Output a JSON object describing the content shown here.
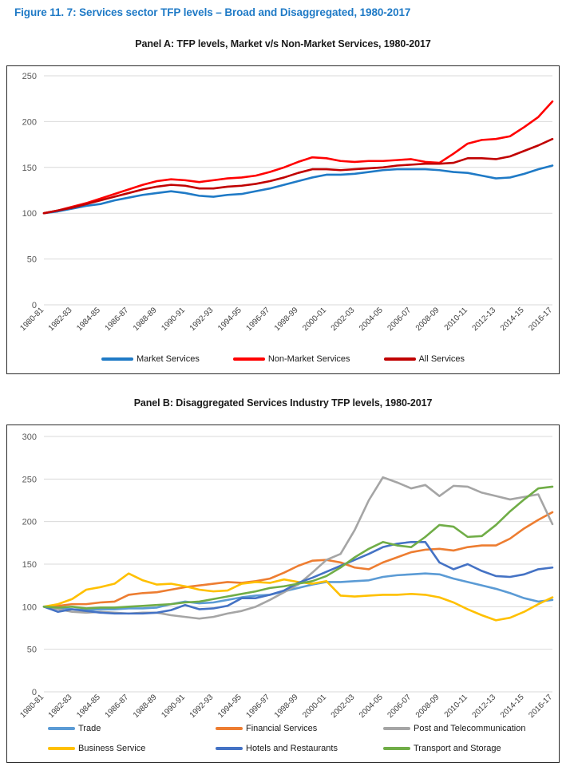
{
  "figure": {
    "title": "Figure 11. 7: Services sector TFP levels – Broad and Disaggregated, 1980-2017",
    "title_color": "#1F7AC6"
  },
  "panelA": {
    "title": "Panel A: TFP levels, Market v/s Non-Market Services, 1980-2017",
    "legend": [
      {
        "label": "Market Services",
        "color": "#1F7AC6"
      },
      {
        "label": "Non-Market Services",
        "color": "#FF0000"
      },
      {
        "label": "All Services",
        "color": "#C00000"
      }
    ]
  },
  "panelB": {
    "title": "Panel B: Disaggregated Services Industry TFP levels, 1980-2017",
    "legend": [
      {
        "label": "Trade",
        "color": "#5B9BD5"
      },
      {
        "label": "Financial Services",
        "color": "#ED7D31"
      },
      {
        "label": "Post and Telecommunication",
        "color": "#A5A5A5"
      },
      {
        "label": "Business Service",
        "color": "#FFC000"
      },
      {
        "label": "Hotels and Restaurants",
        "color": "#4472C4"
      },
      {
        "label": "Transport and Storage",
        "color": "#70AD47"
      }
    ]
  },
  "chart_data": [
    {
      "type": "line",
      "panel": "A",
      "title": "Panel A: TFP levels, Market v/s Non-Market Services, 1980-2017",
      "xlabel": "",
      "ylabel": "",
      "ylim": [
        0,
        250
      ],
      "yticks": [
        0,
        50,
        100,
        150,
        200,
        250
      ],
      "grid": true,
      "legend_position": "bottom",
      "x": [
        "1980-81",
        "1981-82",
        "1982-83",
        "1983-84",
        "1984-85",
        "1985-86",
        "1986-87",
        "1987-88",
        "1988-89",
        "1989-90",
        "1990-91",
        "1991-92",
        "1992-93",
        "1993-94",
        "1994-95",
        "1995-96",
        "1996-97",
        "1997-98",
        "1998-99",
        "1999-00",
        "2000-01",
        "2001-02",
        "2002-03",
        "2003-04",
        "2004-05",
        "2005-06",
        "2006-07",
        "2007-08",
        "2008-09",
        "2009-10",
        "2010-11",
        "2011-12",
        "2012-13",
        "2013-14",
        "2014-15",
        "2015-16",
        "2016-17"
      ],
      "xtick_labels": [
        "1980-81",
        "1982-83",
        "1984-85",
        "1986-87",
        "1988-89",
        "1990-91",
        "1992-93",
        "1994-95",
        "1996-97",
        "1998-99",
        "2000-01",
        "2002-03",
        "2004-05",
        "2006-07",
        "2008-09",
        "2010-11",
        "2012-13",
        "2014-15",
        "2016-17"
      ],
      "series": [
        {
          "name": "Market Services",
          "color": "#1F7AC6",
          "values": [
            100,
            102,
            105,
            108,
            110,
            114,
            117,
            120,
            122,
            124,
            122,
            119,
            118,
            120,
            121,
            124,
            127,
            131,
            135,
            139,
            142,
            142,
            143,
            145,
            147,
            148,
            148,
            148,
            147,
            145,
            144,
            141,
            138,
            139,
            143,
            148,
            152
          ]
        },
        {
          "name": "Non-Market Services",
          "color": "#FF0000",
          "values": [
            100,
            103,
            107,
            111,
            116,
            121,
            126,
            131,
            135,
            137,
            136,
            134,
            136,
            138,
            139,
            141,
            145,
            150,
            156,
            161,
            160,
            157,
            156,
            157,
            157,
            158,
            159,
            156,
            155,
            165,
            176,
            180,
            181,
            184,
            194,
            205,
            222
          ]
        },
        {
          "name": "All Services",
          "color": "#C00000",
          "values": [
            100,
            103,
            106,
            110,
            114,
            118,
            122,
            126,
            129,
            131,
            130,
            127,
            127,
            129,
            130,
            132,
            135,
            139,
            144,
            148,
            148,
            147,
            148,
            149,
            150,
            152,
            153,
            154,
            154,
            155,
            160,
            160,
            159,
            162,
            168,
            174,
            181
          ]
        }
      ]
    },
    {
      "type": "line",
      "panel": "B",
      "title": "Panel B: Disaggregated Services Industry TFP levels, 1980-2017",
      "xlabel": "",
      "ylabel": "",
      "ylim": [
        0,
        300
      ],
      "yticks": [
        0,
        50,
        100,
        150,
        200,
        250,
        300
      ],
      "grid": true,
      "legend_position": "bottom",
      "x": [
        "1980-81",
        "1981-82",
        "1982-83",
        "1983-84",
        "1984-85",
        "1985-86",
        "1986-87",
        "1987-88",
        "1988-89",
        "1989-90",
        "1990-91",
        "1991-92",
        "1992-93",
        "1993-94",
        "1994-95",
        "1995-96",
        "1996-97",
        "1997-98",
        "1998-99",
        "1999-00",
        "2000-01",
        "2001-02",
        "2002-03",
        "2003-04",
        "2004-05",
        "2005-06",
        "2006-07",
        "2007-08",
        "2008-09",
        "2009-10",
        "2010-11",
        "2011-12",
        "2012-13",
        "2013-14",
        "2014-15",
        "2015-16",
        "2016-17"
      ],
      "xtick_labels": [
        "1980-81",
        "1982-83",
        "1984-85",
        "1986-87",
        "1988-89",
        "1990-91",
        "1992-93",
        "1994-95",
        "1996-97",
        "1998-99",
        "2000-01",
        "2002-03",
        "2004-05",
        "2006-07",
        "2008-09",
        "2010-11",
        "2012-13",
        "2014-15",
        "2016-17"
      ],
      "series": [
        {
          "name": "Trade",
          "color": "#5B9BD5",
          "values": [
            100,
            99,
            97,
            96,
            97,
            97,
            98,
            98,
            99,
            103,
            106,
            104,
            105,
            108,
            111,
            113,
            114,
            118,
            122,
            126,
            129,
            129,
            130,
            131,
            135,
            137,
            138,
            139,
            138,
            133,
            129,
            125,
            121,
            116,
            110,
            106,
            108
          ]
        },
        {
          "name": "Financial Services",
          "color": "#ED7D31",
          "values": [
            100,
            101,
            103,
            103,
            105,
            106,
            114,
            116,
            117,
            120,
            123,
            125,
            127,
            129,
            128,
            130,
            133,
            140,
            148,
            154,
            155,
            152,
            146,
            144,
            152,
            158,
            164,
            167,
            168,
            166,
            170,
            172,
            172,
            180,
            192,
            202,
            211
          ]
        },
        {
          "name": "Post and Telecommunication",
          "color": "#A5A5A5",
          "values": [
            100,
            97,
            94,
            93,
            94,
            93,
            92,
            93,
            93,
            90,
            88,
            86,
            88,
            92,
            95,
            100,
            108,
            117,
            126,
            140,
            155,
            162,
            190,
            225,
            252,
            246,
            239,
            243,
            230,
            242,
            241,
            234,
            230,
            226,
            229,
            232,
            197
          ]
        },
        {
          "name": "Business Service",
          "color": "#FFC000",
          "values": [
            100,
            103,
            109,
            120,
            123,
            127,
            139,
            131,
            126,
            127,
            124,
            120,
            118,
            119,
            127,
            129,
            128,
            132,
            129,
            127,
            130,
            113,
            112,
            113,
            114,
            114,
            115,
            114,
            111,
            105,
            97,
            90,
            84,
            87,
            94,
            103,
            111
          ]
        },
        {
          "name": "Hotels and Restaurants",
          "color": "#4472C4",
          "values": [
            100,
            94,
            97,
            95,
            93,
            92,
            92,
            92,
            93,
            96,
            102,
            97,
            98,
            101,
            110,
            110,
            114,
            119,
            128,
            134,
            141,
            148,
            155,
            162,
            170,
            174,
            176,
            176,
            152,
            144,
            150,
            142,
            136,
            135,
            138,
            144,
            146
          ]
        },
        {
          "name": "Transport and Storage",
          "color": "#70AD47",
          "values": [
            100,
            99,
            100,
            98,
            99,
            99,
            100,
            101,
            102,
            103,
            105,
            106,
            109,
            112,
            115,
            118,
            122,
            124,
            127,
            130,
            136,
            146,
            158,
            168,
            176,
            172,
            170,
            182,
            196,
            194,
            182,
            183,
            196,
            212,
            226,
            239,
            241
          ]
        }
      ]
    }
  ]
}
